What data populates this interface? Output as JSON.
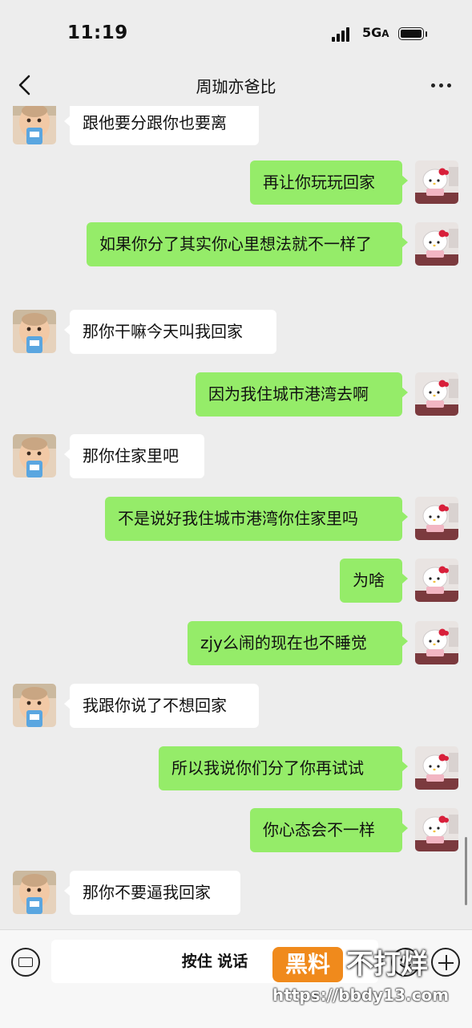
{
  "status_bar": {
    "time": "11:19",
    "network": "5G",
    "network_suffix": "A"
  },
  "nav": {
    "title": "周珈亦爸比"
  },
  "messages": [
    {
      "side": "left",
      "text": "跟他要分跟你也要离"
    },
    {
      "side": "right",
      "text": "再让你玩玩回家"
    },
    {
      "side": "right",
      "text": "如果你分了其实你心里想法就不一样了"
    },
    {
      "side": "left",
      "text": "那你干嘛今天叫我回家"
    },
    {
      "side": "right",
      "text": "因为我住城市港湾去啊"
    },
    {
      "side": "left",
      "text": "那你住家里吧"
    },
    {
      "side": "right",
      "text": "不是说好我住城市港湾你住家里吗"
    },
    {
      "side": "right",
      "text": "为啥"
    },
    {
      "side": "right",
      "text": "zjy么闹的现在也不睡觉"
    },
    {
      "side": "left",
      "text": "我跟你说了不想回家"
    },
    {
      "side": "right",
      "text": "所以我说你们分了你再试试"
    },
    {
      "side": "right",
      "text": "你心态会不一样"
    },
    {
      "side": "left",
      "text": "那你不要逼我回家"
    }
  ],
  "input_bar": {
    "hold_to_talk": "按住 说话"
  },
  "watermark": {
    "badge": "黑料",
    "text": "不打烊",
    "url": "https://bbdy13.com"
  },
  "colors": {
    "background": "#ededed",
    "bubble_self": "#95ec69",
    "bubble_other": "#ffffff",
    "watermark_orange": "#f08a1c"
  }
}
